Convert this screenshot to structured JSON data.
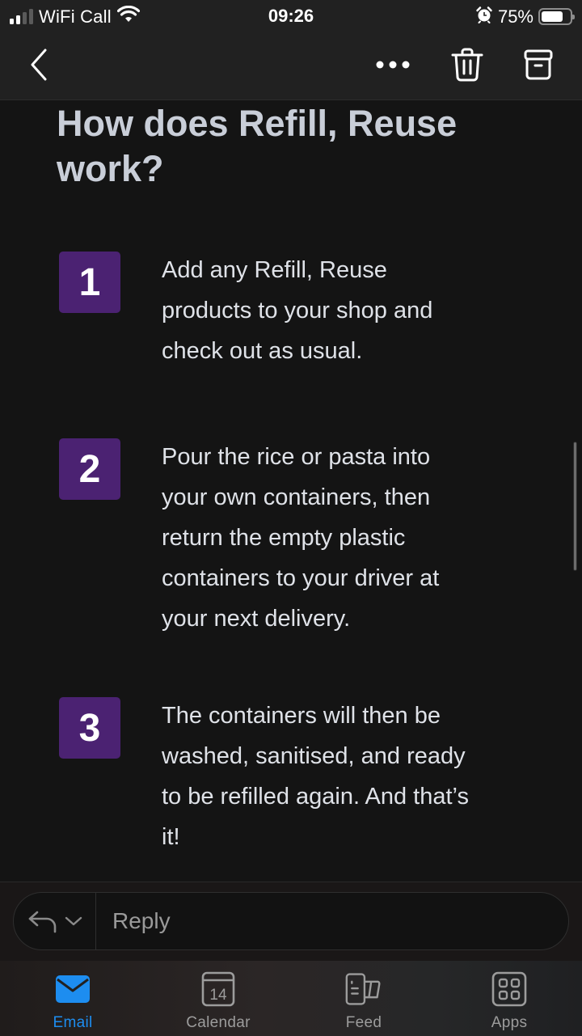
{
  "status_bar": {
    "carrier": "WiFi Call",
    "time": "09:26",
    "battery_percent_label": "75%",
    "battery_level": 0.75,
    "signal_bars_filled": 2,
    "signal_bars_total": 4,
    "icons": [
      "signal-icon",
      "wifi-icon",
      "alarm-icon",
      "battery-icon"
    ]
  },
  "top_nav": {
    "back_icon": "chevron-left-icon",
    "more_icon": "ellipsis-icon",
    "delete_icon": "trash-icon",
    "archive_icon": "archive-icon"
  },
  "email_body": {
    "heading": "How does Refill, Reuse work?",
    "steps": [
      {
        "number": "1",
        "text": "Add any Refill, Reuse products to your shop and check out as usual."
      },
      {
        "number": "2",
        "text": "Pour the rice or pasta into your own containers, then return the empty plastic containers to your driver at your next delivery."
      },
      {
        "number": "3",
        "text": "The containers will then be washed, sanitised, and ready to be refilled again. And that’s it!"
      }
    ]
  },
  "reply_bar": {
    "placeholder": "Reply",
    "value": "",
    "reply_icon": "reply-arrow-icon",
    "dropdown_icon": "chevron-down-icon"
  },
  "tab_bar": {
    "tabs": [
      {
        "label": "Email",
        "icon": "mail-icon",
        "active": true
      },
      {
        "label": "Calendar",
        "icon": "calendar-icon",
        "active": false,
        "icon_text": "14"
      },
      {
        "label": "Feed",
        "icon": "feed-icon",
        "active": false
      },
      {
        "label": "Apps",
        "icon": "apps-grid-icon",
        "active": false
      }
    ]
  },
  "colors": {
    "accent": "#1d8df0",
    "step_badge": "#4b2272",
    "background": "#141414",
    "heading_text": "#c9ced8"
  }
}
